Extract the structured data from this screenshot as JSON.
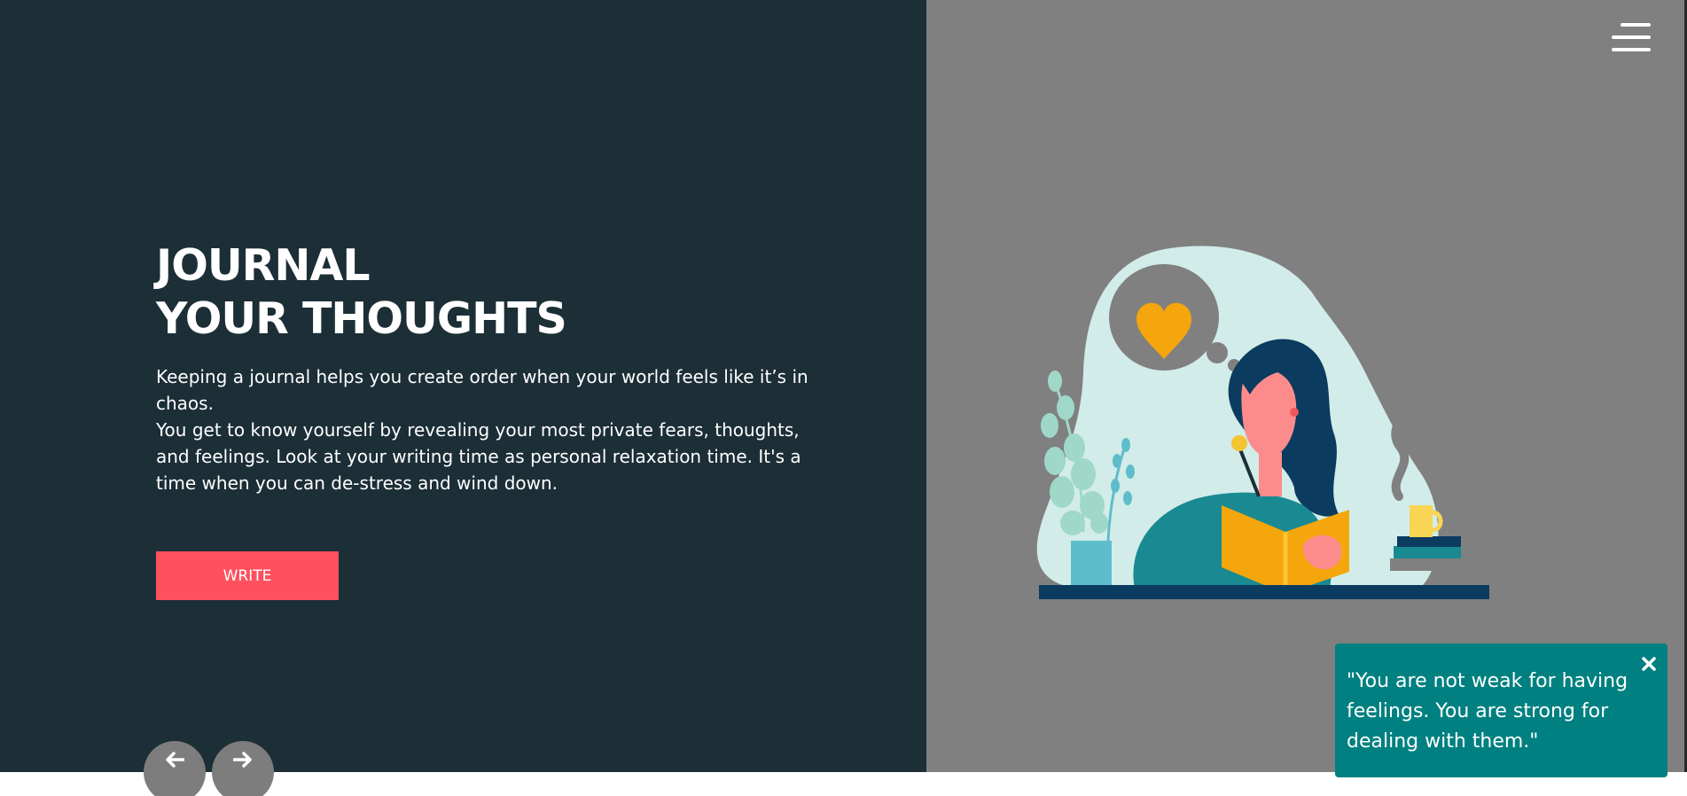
{
  "hero": {
    "title_line1": "JOURNAL",
    "title_line2": "YOUR THOUGHTS",
    "paragraph1": "Keeping a journal helps you create order when your world feels like it’s in chaos.",
    "paragraph2": "You get to know yourself by revealing your most private fears, thoughts, and feelings. Look at your writing time as personal relaxation time. It's a time when you can de-stress and wind down.",
    "write_label": "WRITE"
  },
  "header": {
    "menu_icon": "hamburger-menu-icon"
  },
  "illustration": {
    "subject": "woman-writing-in-journal"
  },
  "carousel": {
    "prev_icon": "arrow-left-icon",
    "next_icon": "arrow-right-icon"
  },
  "quote_toast": {
    "text": "\"You are not weak for having feelings. You are strong for dealing with them.\"",
    "close_icon": "close-icon"
  },
  "colors": {
    "left_panel_bg": "#1c2e36",
    "right_panel_bg": "#808080",
    "write_button_bg": "#ff505e",
    "toast_bg": "#008080",
    "nav_button_bg": "#7d7d7d"
  }
}
